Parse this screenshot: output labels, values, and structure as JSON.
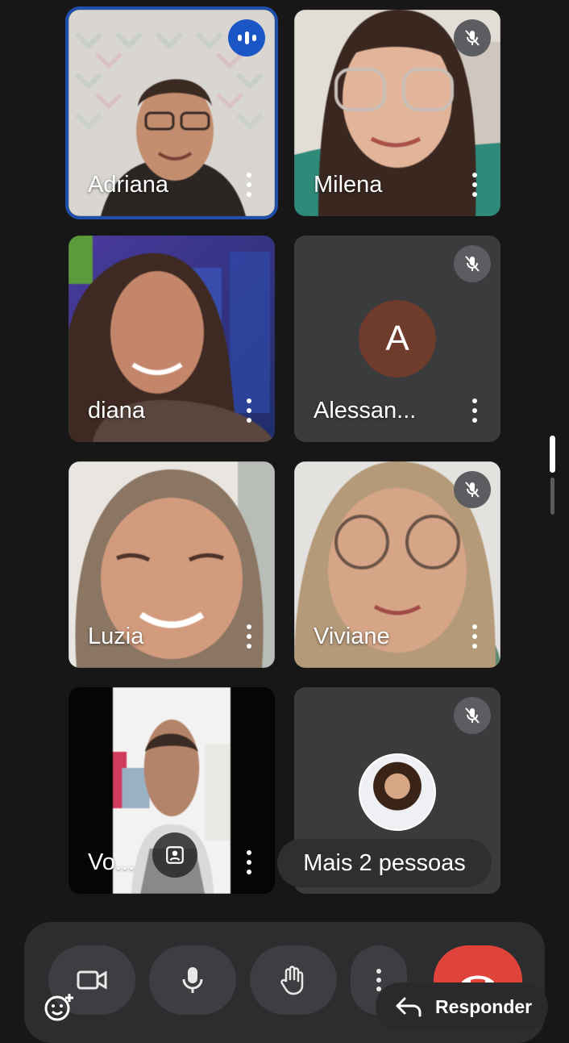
{
  "participants": [
    {
      "name": "Adriana",
      "state": "speaking"
    },
    {
      "name": "Milena",
      "state": "muted"
    },
    {
      "name": "diana",
      "state": "unmuted"
    },
    {
      "name": "Alessan...",
      "state": "muted",
      "avatar_letter": "A"
    },
    {
      "name": "Luzia",
      "state": "unmuted"
    },
    {
      "name": "Viviane",
      "state": "muted"
    },
    {
      "name": "Vo...",
      "state": "self"
    },
    {
      "name": "",
      "state": "muted"
    }
  ],
  "more_people_label": "Mais 2 pessoas",
  "controls": {
    "camera_icon": "video-camera-icon",
    "mic_icon": "microphone-icon",
    "hand_icon": "raise-hand-icon",
    "more_icon": "more-options-icon",
    "end_icon": "end-call-icon"
  },
  "reply_label": "Responder",
  "colors": {
    "background": "#171717",
    "tile": "#3a3b3d",
    "active_border": "#1f4fa8",
    "speaking_badge": "#1a56c6",
    "end_call": "#e0433a",
    "avatar_letter_bg": "#6e3b2d"
  }
}
